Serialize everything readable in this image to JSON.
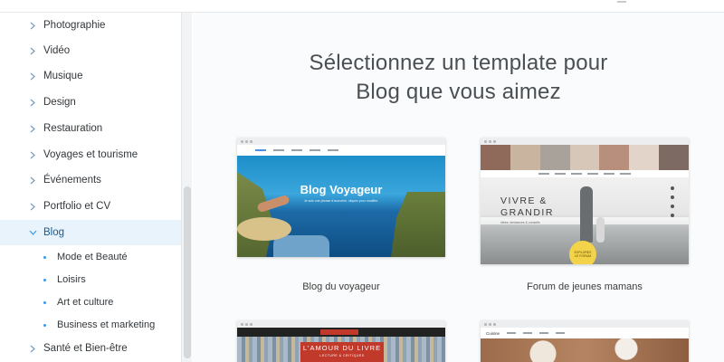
{
  "sidebar": {
    "items": [
      {
        "label": "Photographie"
      },
      {
        "label": "Vidéo"
      },
      {
        "label": "Musique"
      },
      {
        "label": "Design"
      },
      {
        "label": "Restauration"
      },
      {
        "label": "Voyages et tourisme"
      },
      {
        "label": "Événements"
      },
      {
        "label": "Portfolio et CV"
      },
      {
        "label": "Blog",
        "expanded": true,
        "active": true
      }
    ],
    "subitems": [
      {
        "label": "Mode et Beauté"
      },
      {
        "label": "Loisirs"
      },
      {
        "label": "Art et culture"
      },
      {
        "label": "Business et marketing"
      }
    ],
    "after": [
      {
        "label": "Santé et Bien-être"
      }
    ]
  },
  "main": {
    "heading_line1": "Sélectionnez un template pour",
    "heading_line2": "Blog que vous aimez",
    "templates": [
      {
        "caption": "Blog du voyageur",
        "thumb_title": "Blog Voyageur",
        "thumb_sub": "Je suis une phrase d'accroche, cliquez pour modifier."
      },
      {
        "caption": "Forum de jeunes mamans",
        "thumb_title_line1": "VIVRE &",
        "thumb_title_line2": "GRANDIR",
        "thumb_tag": "Idées, tendances & conseils",
        "badge_line1": "EXPLOREZ",
        "badge_line2": "LE FORUM"
      },
      {
        "thumb_title": "L'AMOUR DU LIVRE",
        "thumb_sub": "LECTURE & CRITIQUES"
      },
      {
        "thumb_brand": "Cuisine"
      }
    ]
  },
  "colors": {
    "accent": "#3899ec",
    "active_bg": "#e8f3fc",
    "text": "#32373b",
    "heading": "#4a4f54"
  }
}
